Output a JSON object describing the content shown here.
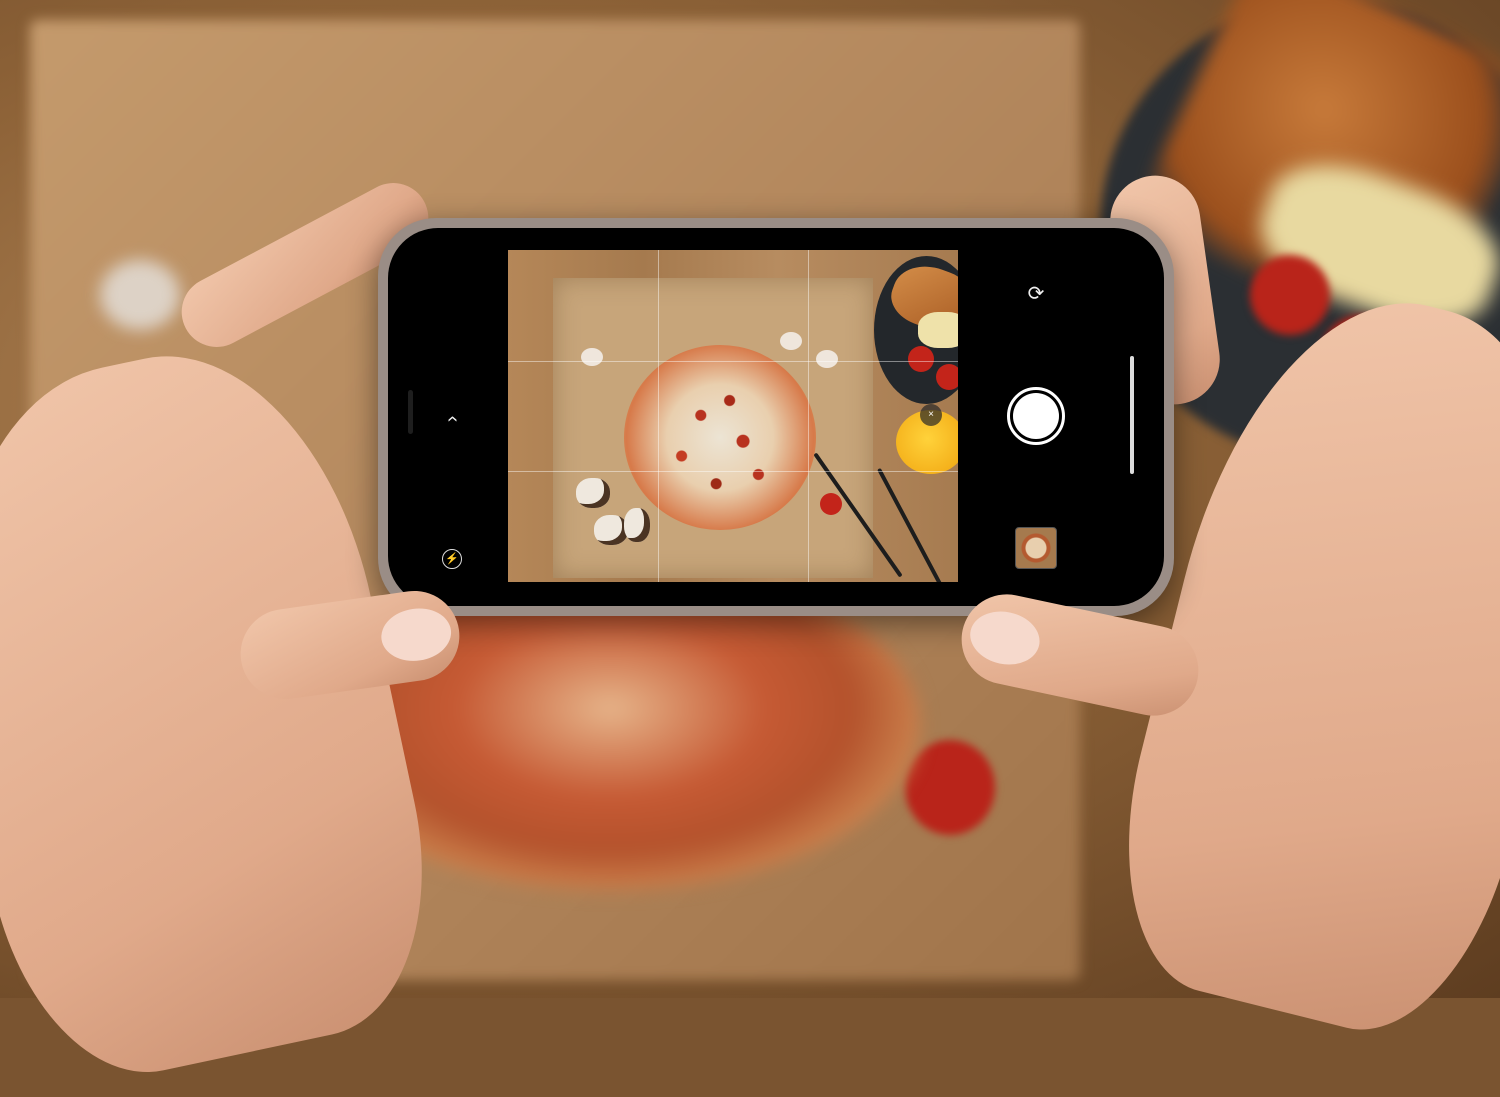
{
  "scene": {
    "description_icons": [
      "pizza",
      "croissant-sandwich",
      "tomato",
      "mushroom",
      "garlic",
      "fork",
      "knife",
      "orange-juice"
    ]
  },
  "camera_ui": {
    "mode": "photo",
    "grid_enabled": true,
    "zoom_label": "×",
    "icons": {
      "back": "chevron-icon",
      "flash": "flash-icon",
      "switch": "switch-camera-icon",
      "shutter": "shutter-icon",
      "thumbnail": "last-photo-thumbnail"
    },
    "glyphs": {
      "back": "‹",
      "flash": "⚡",
      "switch": "⟳"
    }
  },
  "colors": {
    "phone_frame": "#9a8d86",
    "shutter": "#ffffff",
    "table": "#8e6338"
  }
}
